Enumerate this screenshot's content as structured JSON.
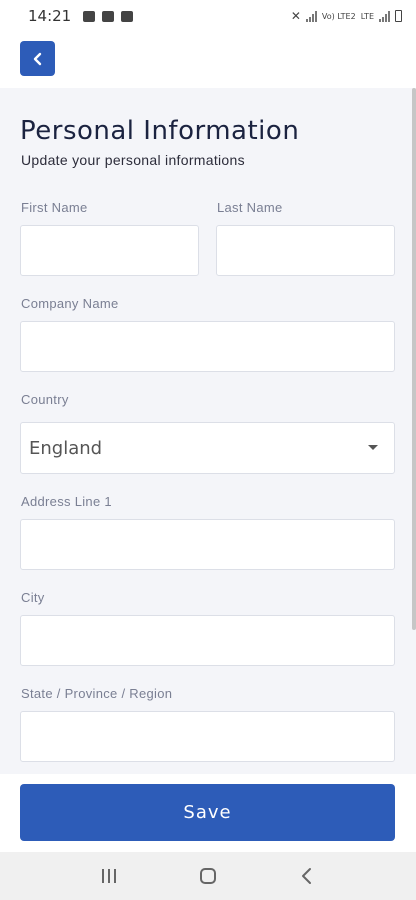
{
  "status_bar": {
    "time": "14:21",
    "carrier_labels": [
      "Vo) LTE2",
      "LTE"
    ]
  },
  "header": {
    "back_icon": "chevron-left-icon"
  },
  "page": {
    "title": "Personal Information",
    "subtitle": "Update your personal informations"
  },
  "form": {
    "first_name": {
      "label": "First Name",
      "value": ""
    },
    "last_name": {
      "label": "Last Name",
      "value": ""
    },
    "company_name": {
      "label": "Company Name",
      "value": ""
    },
    "country": {
      "label": "Country",
      "value": "England"
    },
    "address_line_1": {
      "label": "Address Line 1",
      "value": ""
    },
    "city": {
      "label": "City",
      "value": ""
    },
    "state_region": {
      "label": "State / Province / Region",
      "value": ""
    }
  },
  "footer": {
    "save_label": "Save"
  },
  "colors": {
    "accent": "#2d5cb8",
    "background": "#f4f5f9",
    "title": "#1b2340",
    "label": "#7a7f93"
  }
}
